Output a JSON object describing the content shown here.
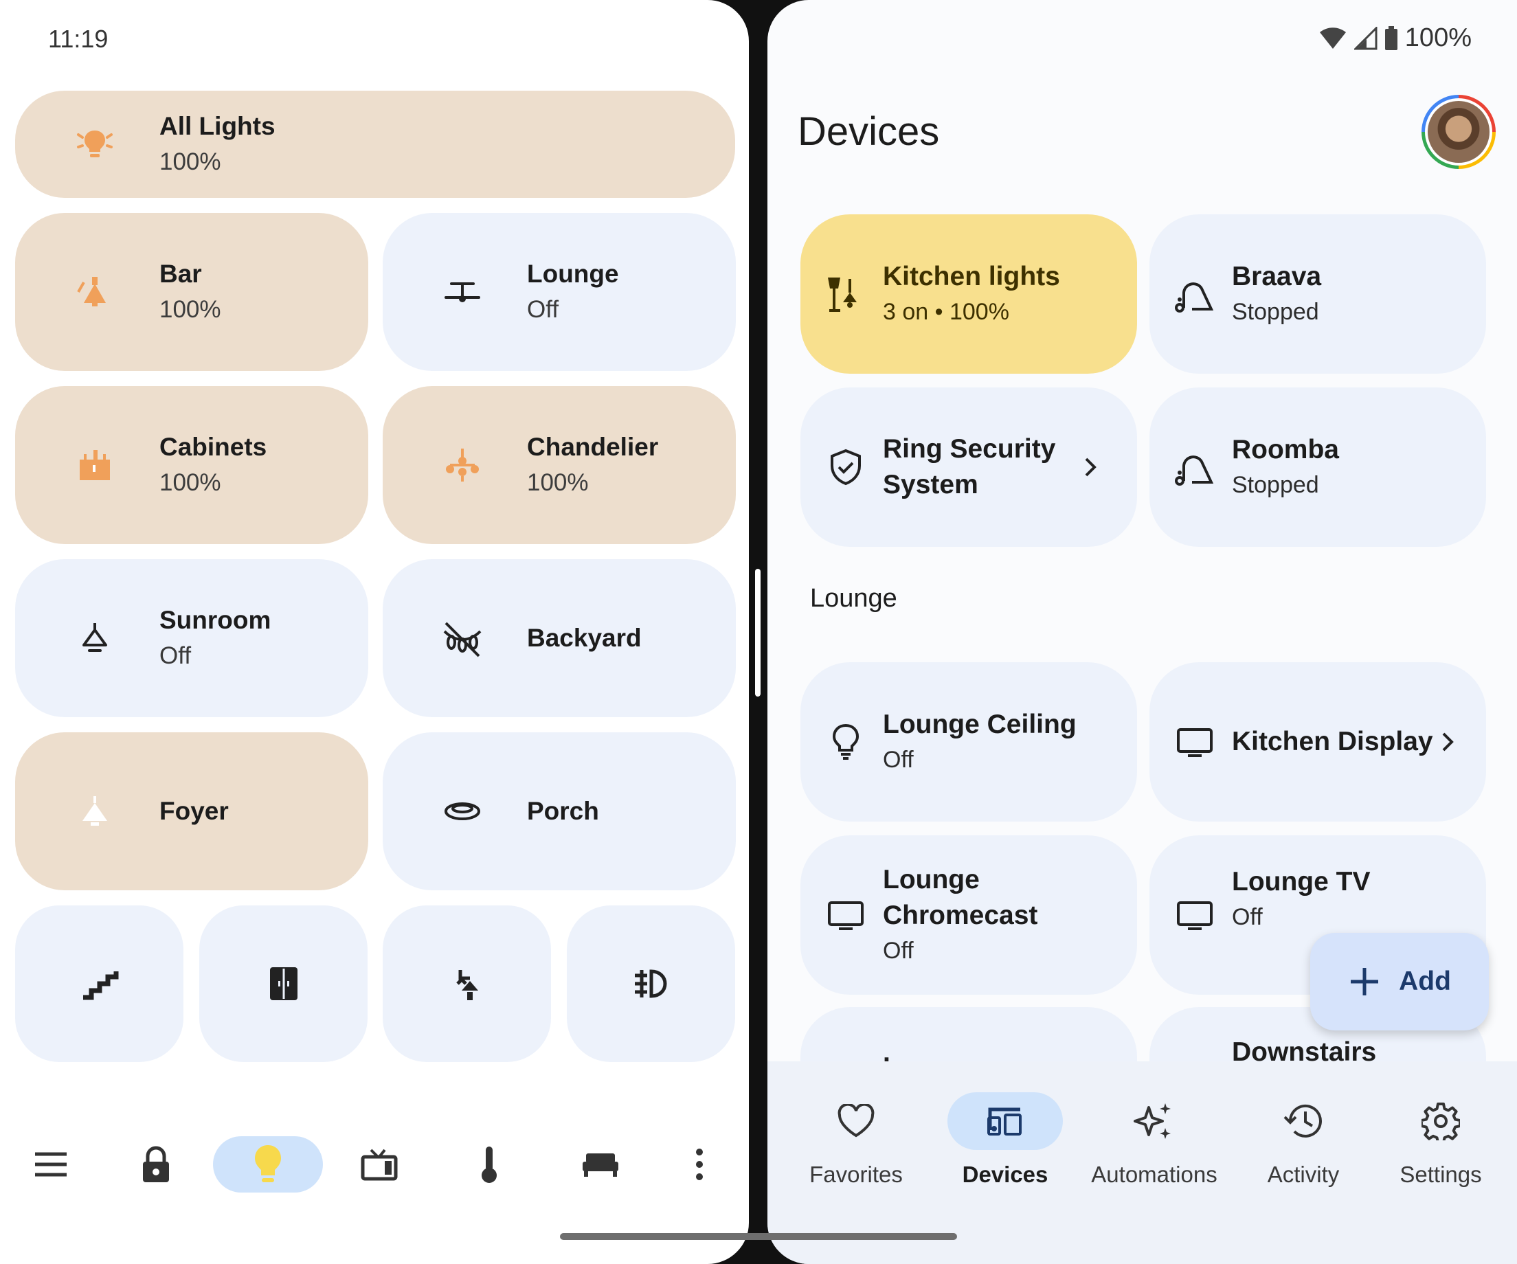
{
  "status": {
    "time": "11:19",
    "battery": "100%"
  },
  "lights": {
    "all": {
      "name": "All Lights",
      "sub": "100%"
    },
    "tiles": [
      {
        "name": "Bar",
        "sub": "100%"
      },
      {
        "name": "Lounge",
        "sub": "Off"
      },
      {
        "name": "Cabinets",
        "sub": "100%"
      },
      {
        "name": "Chandelier",
        "sub": "100%"
      },
      {
        "name": "Sunroom",
        "sub": "Off"
      },
      {
        "name": "Backyard",
        "sub": ""
      },
      {
        "name": "Foyer",
        "sub": ""
      },
      {
        "name": "Porch",
        "sub": ""
      }
    ],
    "small_icons": [
      "stairs-icon",
      "cabinet-icon",
      "wall-lamp-icon",
      "fog-light-icon"
    ]
  },
  "left_nav": [
    "menu-icon",
    "lock-icon",
    "lightbulb-icon",
    "tv-icon",
    "thermometer-icon",
    "bed-icon",
    "more-vert-icon"
  ],
  "devices": {
    "title": "Devices",
    "tiles": [
      {
        "name": "Kitchen lights",
        "sub": "3 on • 100%"
      },
      {
        "name": "Braava",
        "sub": "Stopped"
      },
      {
        "name": "Ring Security System",
        "sub": ""
      },
      {
        "name": "Roomba",
        "sub": "Stopped"
      }
    ],
    "section": "Lounge",
    "lounge_tiles": [
      {
        "name": "Lounge Ceiling",
        "sub": "Off"
      },
      {
        "name": "Kitchen Display",
        "sub": ""
      },
      {
        "name": "Lounge Chromecast",
        "sub": "Off"
      },
      {
        "name": "Lounge TV",
        "sub": "Off"
      },
      {
        "name": "L",
        "sub": ""
      },
      {
        "name": "Downstairs",
        "sub": ""
      }
    ],
    "fab_label": "Add"
  },
  "bottom_nav": [
    {
      "label": "Favorites",
      "icon": "heart-icon"
    },
    {
      "label": "Devices",
      "icon": "devices-icon"
    },
    {
      "label": "Automations",
      "icon": "sparkle-icon"
    },
    {
      "label": "Activity",
      "icon": "history-icon"
    },
    {
      "label": "Settings",
      "icon": "gear-icon"
    }
  ],
  "colors": {
    "on_tile": "#eddecd",
    "off_tile": "#edf2fb",
    "yellow_tile": "#f8e08e",
    "accent_pill": "#cfe3fb",
    "orange_icon": "#f0a05a"
  }
}
